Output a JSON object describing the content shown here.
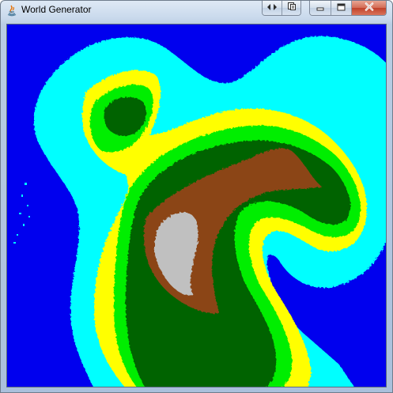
{
  "window": {
    "title": "World Generator"
  },
  "caption_buttons": {
    "extra": [
      {
        "icon": "arrows-icon"
      },
      {
        "icon": "restore-pages-icon"
      }
    ],
    "main": [
      {
        "icon": "minimize-icon"
      },
      {
        "icon": "maximize-icon"
      },
      {
        "icon": "close-icon"
      }
    ]
  },
  "map": {
    "terrain_colors": {
      "deep_water": "#0000ee",
      "shallow_water": "#00ffff",
      "beach": "#ffff00",
      "grassland": "#00ee00",
      "forest": "#006400",
      "hills": "#8b4513",
      "mountain": "#c0c0c0"
    }
  }
}
